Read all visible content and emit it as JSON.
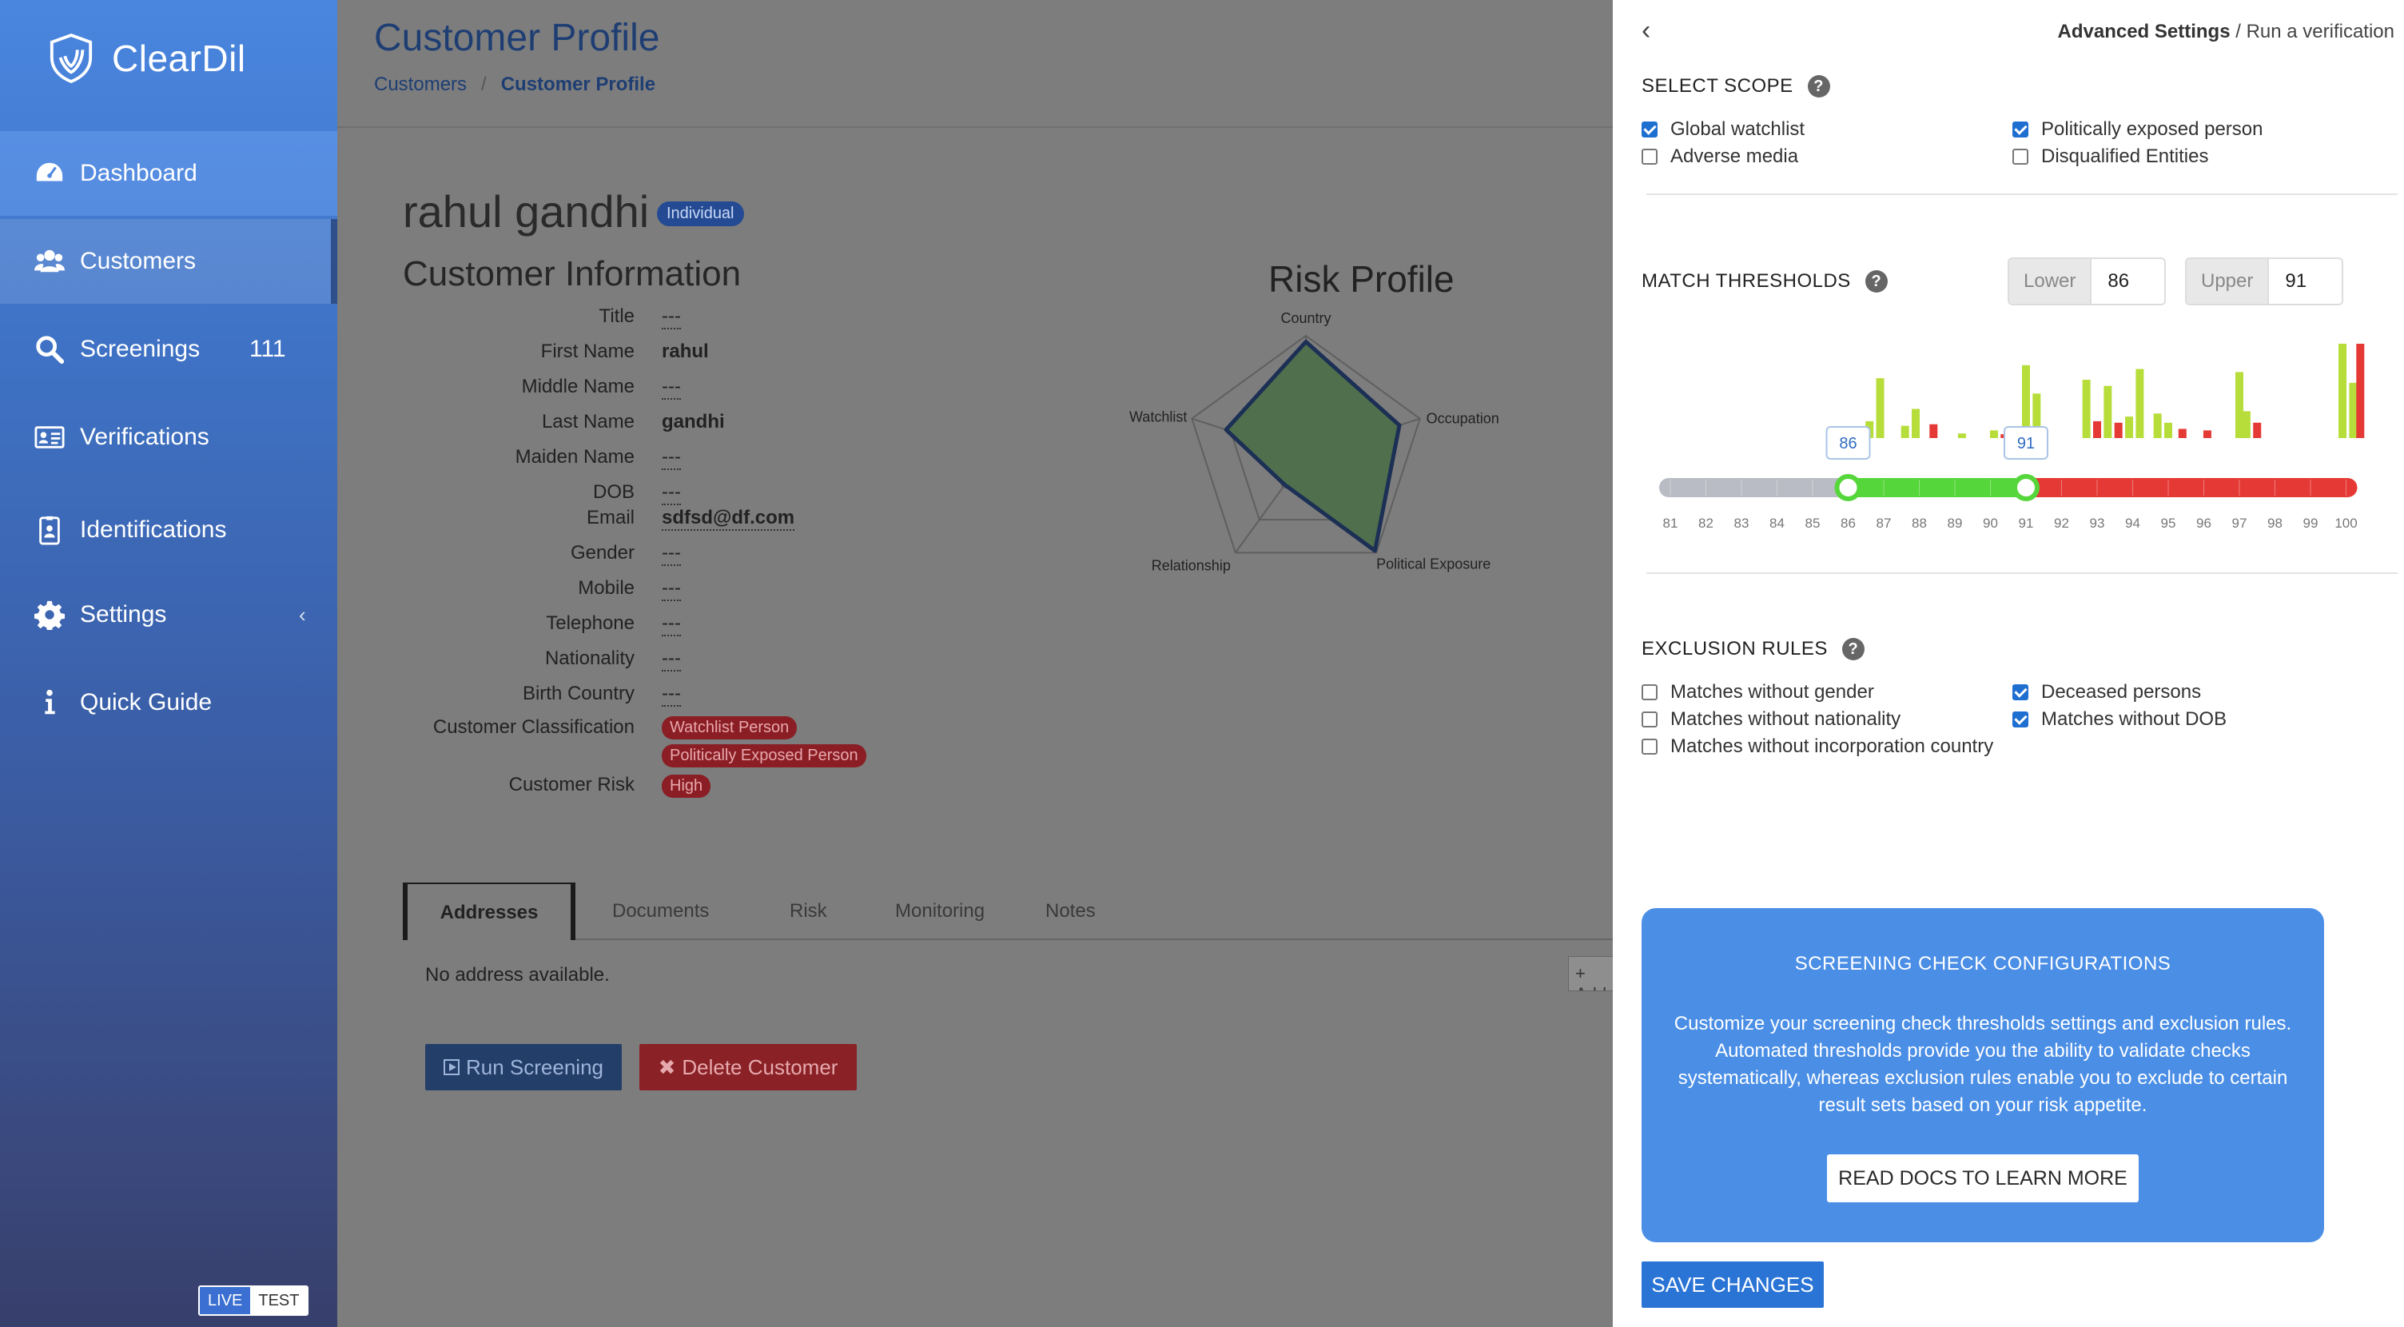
{
  "sidebar": {
    "brand": "ClearDil",
    "items": [
      {
        "label": "Dashboard",
        "icon": "dashboard-icon"
      },
      {
        "label": "Customers",
        "icon": "users-icon"
      },
      {
        "label": "Screenings",
        "icon": "search-icon",
        "count": "111"
      },
      {
        "label": "Verifications",
        "icon": "id-card-icon"
      },
      {
        "label": "Identifications",
        "icon": "id-badge-icon"
      },
      {
        "label": "Settings",
        "icon": "gear-icon"
      },
      {
        "label": "Quick Guide",
        "icon": "info-icon"
      }
    ],
    "mode": {
      "live": "LIVE",
      "test": "TEST"
    }
  },
  "header": {
    "title": "Customer Profile",
    "breadcrumb": [
      "Customers",
      "Customer Profile"
    ]
  },
  "customer": {
    "name": "rahul gandhi",
    "type": "Individual",
    "section_title": "Customer Information",
    "fields": [
      {
        "label": "Title",
        "value": "---"
      },
      {
        "label": "First Name",
        "value": "rahul"
      },
      {
        "label": "Middle Name",
        "value": "---"
      },
      {
        "label": "Last Name",
        "value": "gandhi"
      },
      {
        "label": "Maiden Name",
        "value": "---"
      },
      {
        "label": "DOB",
        "value": "---"
      },
      {
        "label": "Email",
        "value": "sdfsd@df.com"
      },
      {
        "label": "Gender",
        "value": "---"
      },
      {
        "label": "Mobile",
        "value": "---"
      },
      {
        "label": "Telephone",
        "value": "---"
      },
      {
        "label": "Nationality",
        "value": "---"
      },
      {
        "label": "Birth Country",
        "value": "---"
      }
    ],
    "classification_label": "Customer Classification",
    "classifications": [
      "Watchlist Person",
      "Politically Exposed Person"
    ],
    "risk_label": "Customer Risk",
    "risk": "High"
  },
  "risk_profile": {
    "title": "Risk Profile",
    "axes": [
      "Country",
      "Occupation",
      "Political Exposure",
      "Relationship",
      "Watchlist"
    ],
    "values": [
      0.95,
      0.82,
      0.98,
      0.3,
      0.7
    ]
  },
  "tabs": [
    "Addresses",
    "Documents",
    "Risk",
    "Monitoring",
    "Notes"
  ],
  "addresses": {
    "empty": "No address available.",
    "add": "+ Add"
  },
  "actions": {
    "run": "Run Screening",
    "delete": "Delete Customer"
  },
  "panel": {
    "crumb_bold": "Advanced Settings",
    "crumb_rest": " / Run a verification",
    "scope": {
      "title": "SELECT SCOPE",
      "options": [
        {
          "label": "Global watchlist",
          "checked": true
        },
        {
          "label": "Politically exposed person",
          "checked": true
        },
        {
          "label": "Adverse media",
          "checked": false
        },
        {
          "label": "Disqualified Entities",
          "checked": false
        }
      ]
    },
    "thresholds": {
      "title": "MATCH THRESHOLDS",
      "lower_label": "Lower",
      "lower": "86",
      "upper_label": "Upper",
      "upper": "91",
      "ticks": [
        "81",
        "82",
        "83",
        "84",
        "85",
        "86",
        "87",
        "88",
        "89",
        "90",
        "91",
        "92",
        "93",
        "94",
        "95",
        "96",
        "97",
        "98",
        "99",
        "100"
      ],
      "colors": {
        "low": "#b9bcc4",
        "mid": "#55d63a",
        "high": "#e53935",
        "bar_mid": "#b7dd3a"
      }
    },
    "exclusion": {
      "title": "EXCLUSION RULES",
      "options": [
        {
          "label": "Matches without gender",
          "checked": false
        },
        {
          "label": "Deceased persons",
          "checked": true
        },
        {
          "label": "Matches without nationality",
          "checked": false
        },
        {
          "label": "Matches without DOB",
          "checked": true
        },
        {
          "label": "Matches without incorporation country",
          "checked": false
        }
      ]
    },
    "info": {
      "title": "SCREENING CHECK CONFIGURATIONS",
      "description": "Customize your screening check thresholds settings and exclusion rules. Automated thresholds provide you the ability to validate checks systematically, whereas exclusion rules enable you to exclude to certain result sets based on your risk appetite.",
      "button": "READ DOCS TO LEARN MORE"
    },
    "save": "SAVE CHANGES"
  }
}
